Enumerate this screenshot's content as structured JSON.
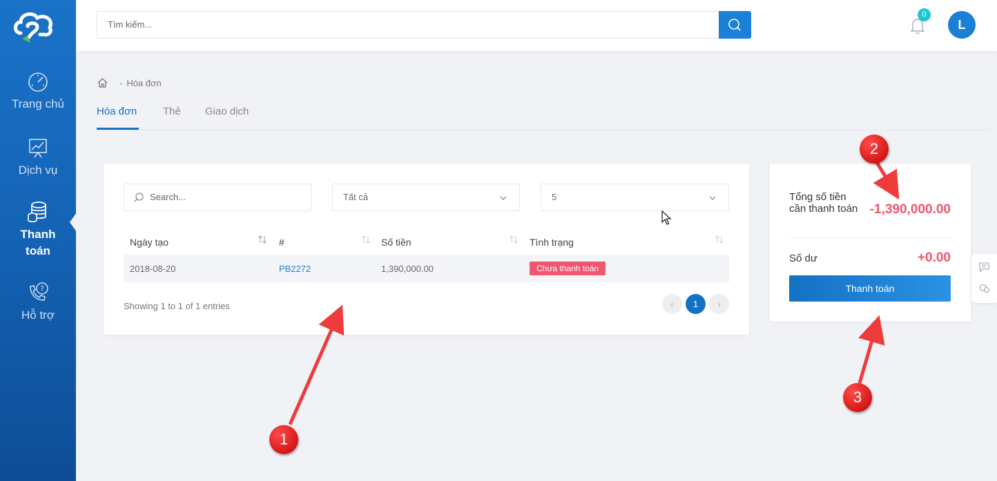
{
  "sidebar": {
    "items": [
      {
        "label": "Trang chủ",
        "icon": "speedometer-icon"
      },
      {
        "label": "Dịch vụ",
        "icon": "chart-board-icon"
      },
      {
        "label": "Thanh toán",
        "icon": "coins-icon"
      },
      {
        "label": "Hỗ trợ",
        "icon": "phone-help-icon"
      }
    ],
    "active": "Thanh toán"
  },
  "header": {
    "search_placeholder": "Tìm kiếm...",
    "notification_count": "0",
    "avatar_initial": "L"
  },
  "breadcrumb": {
    "separator": "-",
    "current": "Hóa đơn"
  },
  "tabs": [
    {
      "label": "Hóa đơn",
      "active": true
    },
    {
      "label": "Thẻ",
      "active": false
    },
    {
      "label": "Giao dịch",
      "active": false
    }
  ],
  "invoices": {
    "search_placeholder": "Search...",
    "status_filter": "Tất cả",
    "page_size": "5",
    "columns": [
      "Ngày tạo",
      "#",
      "Số tiền",
      "Tình trạng"
    ],
    "rows": [
      {
        "date": "2018-08-20",
        "id": "PB2272",
        "amount": "1,390,000.00",
        "status": "Chưa thanh toán"
      }
    ],
    "showing": "Showing 1 to 1 of 1 entries",
    "pagination": {
      "prev": "‹",
      "current": "1",
      "next": "›"
    }
  },
  "summary": {
    "total_label": "Tổng số tiền cần thanh toán",
    "total_value": "-1,390,000.00",
    "balance_label": "Số dư",
    "balance_value": "+0.00",
    "pay_button": "Thanh toán"
  },
  "annotations": [
    "1",
    "2",
    "3"
  ],
  "colors": {
    "primary": "#1471c4",
    "danger": "#f0566e",
    "sidebar": "#1a6cc0",
    "annotation": "#e00000"
  }
}
